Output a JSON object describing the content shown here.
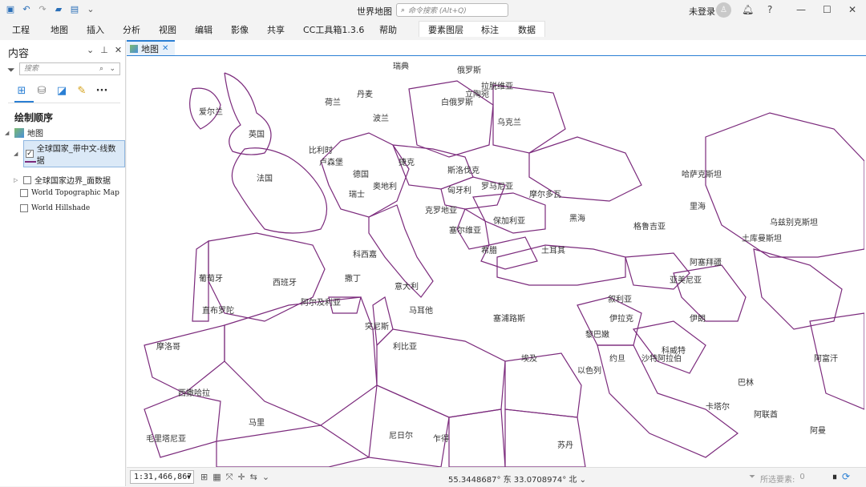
{
  "window": {
    "title": "世界地图",
    "command_search_placeholder": "命令搜索 (Alt+Q)",
    "user": "未登录"
  },
  "ribbon": {
    "tabs": [
      "工程",
      "地图",
      "插入",
      "分析",
      "视图",
      "编辑",
      "影像",
      "共享",
      "CC工具箱1.3.6",
      "帮助"
    ],
    "context_tabs": [
      "要素图层",
      "标注",
      "数据"
    ]
  },
  "contents": {
    "title": "内容",
    "search_placeholder": "搜索",
    "drawing_order": "绘制顺序",
    "map_name": "地图",
    "layers": [
      {
        "name": "全球国家_带中文-线数据",
        "checked": true,
        "expanded": true,
        "selected": true
      },
      {
        "name": "全球国家边界_面数据",
        "checked": false,
        "expanded": false
      },
      {
        "name": "World Topographic Map",
        "checked": false
      },
      {
        "name": "World Hillshade",
        "checked": false
      }
    ]
  },
  "map": {
    "tab_label": "地图",
    "labels": [
      "爱尔兰",
      "英国",
      "荷兰",
      "波兰",
      "德国",
      "法国",
      "瑞士",
      "奥地利",
      "白俄罗斯",
      "俄罗斯",
      "乌克兰",
      "捷克",
      "斯洛伐克",
      "匈牙利",
      "罗马尼亚",
      "摩尔多瓦",
      "保加利亚",
      "意大利",
      "西班牙",
      "葡萄牙",
      "阿尔及利亚",
      "突尼斯",
      "利比亚",
      "埃及",
      "土耳其",
      "叙利亚",
      "伊拉克",
      "伊朗",
      "沙特阿拉伯",
      "约旦",
      "希腊",
      "摩洛哥",
      "西撒哈拉",
      "马里",
      "尼日尔",
      "乍得",
      "苏丹",
      "毛里塔尼亚",
      "格鲁吉亚",
      "阿塞拜疆",
      "亚美尼亚",
      "哈萨克斯坦",
      "土库曼斯坦",
      "乌兹别克斯坦",
      "阿富汗",
      "巴林",
      "阿曼",
      "塞浦路斯",
      "里海",
      "黑海",
      "克罗地亚",
      "塞尔维亚",
      "立陶宛",
      "拉脱维亚",
      "瑞典",
      "丹麦",
      "比利时",
      "卢森堡",
      "黎巴嫩",
      "以色列",
      "科威特",
      "卡塔尔",
      "阿联酋",
      "科西嘉",
      "撒丁",
      "马耳他",
      "直布罗陀"
    ]
  },
  "status": {
    "scale": "1:31,466,867",
    "coordinates": "55.3448687° 东 33.0708974° 北",
    "selected_features_label": "所选要素:",
    "selected_features_count": "0"
  },
  "colors": {
    "boundary": "#7b2a7c",
    "accent": "#2a7fd4"
  }
}
